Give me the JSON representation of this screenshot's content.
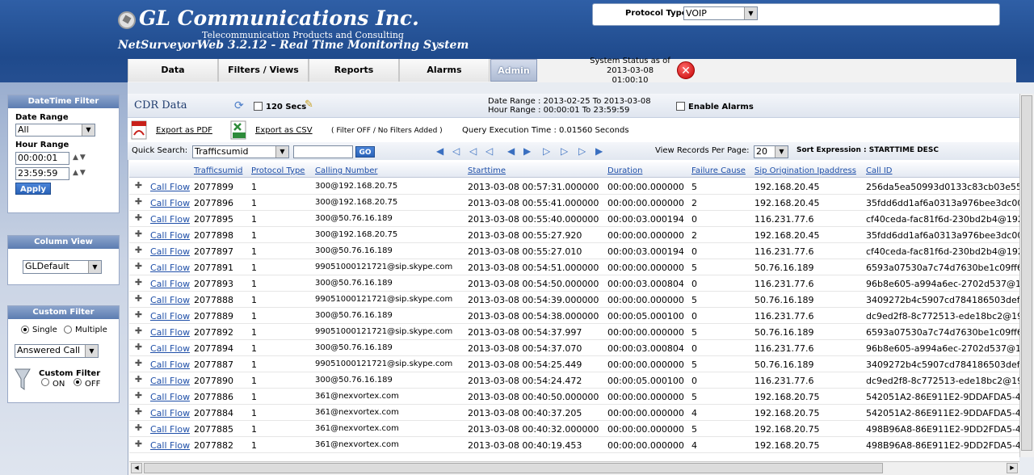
{
  "header": {
    "company": "GL Communications Inc.",
    "tagline": "Telecommunication Products and Consulting",
    "product": "NetSurveyorWeb 3.2.12 - Real Time Monitoring System"
  },
  "protocol": {
    "label": "Protocol Type",
    "value": "VOIP"
  },
  "nav": {
    "tabs": [
      "Data",
      "Filters / Views",
      "Reports",
      "Alarms",
      "Admin"
    ],
    "active": "Admin"
  },
  "system_status": {
    "line1": "System Status as of",
    "line2": "2013-03-08",
    "line3": "01:00:10"
  },
  "datetime_filter": {
    "title": "DateTime Filter",
    "date_range_label": "Date Range",
    "date_range_value": "All",
    "hour_range_label": "Hour Range",
    "hour_from": "00:00:01",
    "hour_to": "23:59:59",
    "apply": "Apply"
  },
  "column_view": {
    "title": "Column View",
    "value": "GLDefault"
  },
  "custom_filter": {
    "title": "Custom Filter",
    "single": "Single",
    "multiple": "Multiple",
    "value": "Answered Call",
    "custom_filter_label": "Custom Filter",
    "on": "ON",
    "off": "OFF"
  },
  "cdr": {
    "title": "CDR Data",
    "refresh_label": "120 Secs",
    "date_range": "Date Range : 2013-02-25 To 2013-03-08",
    "hour_range": "Hour Range : 00:00:01 To 23:59:59",
    "enable_alarms": "Enable Alarms",
    "export_pdf": "Export as PDF",
    "export_csv": "Export as CSV",
    "filter_status": "( Filter OFF / No Filters Added )",
    "query_time": "Query Execution Time : 0.01560 Seconds",
    "quick_search_label": "Quick Search:",
    "quick_search_field": "Trafficsumid",
    "quick_search_value": "",
    "go": "GO",
    "view_records_label": "View Records Per Page:",
    "view_records_value": "20",
    "sort_expression": "Sort Expression : STARTTIME DESC"
  },
  "table": {
    "columns": [
      "Trafficsumid",
      "Protocol Type",
      "Calling Number",
      "Starttime",
      "Duration",
      "Failure Cause",
      "Sip Origination Ipaddress",
      "Call ID"
    ],
    "link_label": "Call Flow",
    "rows": [
      [
        "2077899",
        "1",
        "300@192.168.20.75",
        "2013-03-08 00:57:31.000000",
        "00:00:00.000000",
        "5",
        "192.168.20.45",
        "256da5ea50993d0133c83cb03e553"
      ],
      [
        "2077896",
        "1",
        "300@192.168.20.75",
        "2013-03-08 00:55:41.000000",
        "00:00:00.000000",
        "2",
        "192.168.20.45",
        "35fdd6dd1af6a0313a976bee3dc000"
      ],
      [
        "2077895",
        "1",
        "300@50.76.16.189",
        "2013-03-08 00:55:40.000000",
        "00:00:03.000194",
        "0",
        "116.231.77.6",
        "cf40ceda-fac81f6d-230bd2b4@192.1"
      ],
      [
        "2077898",
        "1",
        "300@192.168.20.75",
        "2013-03-08 00:55:27.920",
        "00:00:00.000000",
        "2",
        "192.168.20.45",
        "35fdd6dd1af6a0313a976bee3dc000"
      ],
      [
        "2077897",
        "1",
        "300@50.76.16.189",
        "2013-03-08 00:55:27.010",
        "00:00:03.000194",
        "0",
        "116.231.77.6",
        "cf40ceda-fac81f6d-230bd2b4@192.1"
      ],
      [
        "2077891",
        "1",
        "99051000121721@sip.skype.com",
        "2013-03-08 00:54:51.000000",
        "00:00:00.000000",
        "5",
        "50.76.16.189",
        "6593a07530a7c74d7630be1c09ff6"
      ],
      [
        "2077893",
        "1",
        "300@50.76.16.189",
        "2013-03-08 00:54:50.000000",
        "00:00:03.000804",
        "0",
        "116.231.77.6",
        "96b8e605-a994a6ec-2702d537@19"
      ],
      [
        "2077888",
        "1",
        "99051000121721@sip.skype.com",
        "2013-03-08 00:54:39.000000",
        "00:00:00.000000",
        "5",
        "50.76.16.189",
        "3409272b4c5907cd784186503defb"
      ],
      [
        "2077889",
        "1",
        "300@50.76.16.189",
        "2013-03-08 00:54:38.000000",
        "00:00:05.000100",
        "0",
        "116.231.77.6",
        "dc9ed2f8-8c772513-ede18bc2@192"
      ],
      [
        "2077892",
        "1",
        "99051000121721@sip.skype.com",
        "2013-03-08 00:54:37.997",
        "00:00:00.000000",
        "5",
        "50.76.16.189",
        "6593a07530a7c74d7630be1c09ff6"
      ],
      [
        "2077894",
        "1",
        "300@50.76.16.189",
        "2013-03-08 00:54:37.070",
        "00:00:03.000804",
        "0",
        "116.231.77.6",
        "96b8e605-a994a6ec-2702d537@19"
      ],
      [
        "2077887",
        "1",
        "99051000121721@sip.skype.com",
        "2013-03-08 00:54:25.449",
        "00:00:00.000000",
        "5",
        "50.76.16.189",
        "3409272b4c5907cd784186503defb"
      ],
      [
        "2077890",
        "1",
        "300@50.76.16.189",
        "2013-03-08 00:54:24.472",
        "00:00:05.000100",
        "0",
        "116.231.77.6",
        "dc9ed2f8-8c772513-ede18bc2@192"
      ],
      [
        "2077886",
        "1",
        "361@nexvortex.com",
        "2013-03-08 00:40:50.000000",
        "00:00:00.000000",
        "5",
        "192.168.20.75",
        "542051A2-86E911E2-9DDAFDA5-4"
      ],
      [
        "2077884",
        "1",
        "361@nexvortex.com",
        "2013-03-08 00:40:37.205",
        "00:00:00.000000",
        "4",
        "192.168.20.75",
        "542051A2-86E911E2-9DDAFDA5-4"
      ],
      [
        "2077885",
        "1",
        "361@nexvortex.com",
        "2013-03-08 00:40:32.000000",
        "00:00:00.000000",
        "5",
        "192.168.20.75",
        "498B96A8-86E911E2-9DD2FDA5-4"
      ],
      [
        "2077882",
        "1",
        "361@nexvortex.com",
        "2013-03-08 00:40:19.453",
        "00:00:00.000000",
        "4",
        "192.168.20.75",
        "498B96A8-86E911E2-9DD2FDA5-4"
      ]
    ]
  }
}
